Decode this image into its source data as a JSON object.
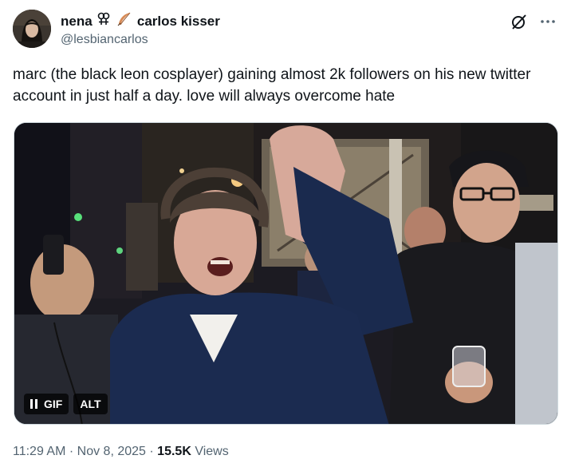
{
  "author": {
    "display_name_part1": "nena",
    "display_name_part2": "carlos kisser",
    "handle": "@lesbiancarlos",
    "emojis": [
      "sapphic-symbol-icon",
      "feather-icon"
    ]
  },
  "tweet": {
    "text": "marc (the black leon cosplayer) gaining almost 2k followers on his new twitter account in just half a day. love will always overcome hate"
  },
  "media": {
    "type": "gif",
    "gif_label": "GIF",
    "alt_label": "ALT"
  },
  "meta": {
    "time": "11:29 AM",
    "separator": "·",
    "date": "Nov 8, 2025",
    "views_count": "15.5K",
    "views_label": "Views"
  },
  "colors": {
    "text": "#0f1419",
    "secondary": "#536471",
    "border": "#cfd9de"
  }
}
